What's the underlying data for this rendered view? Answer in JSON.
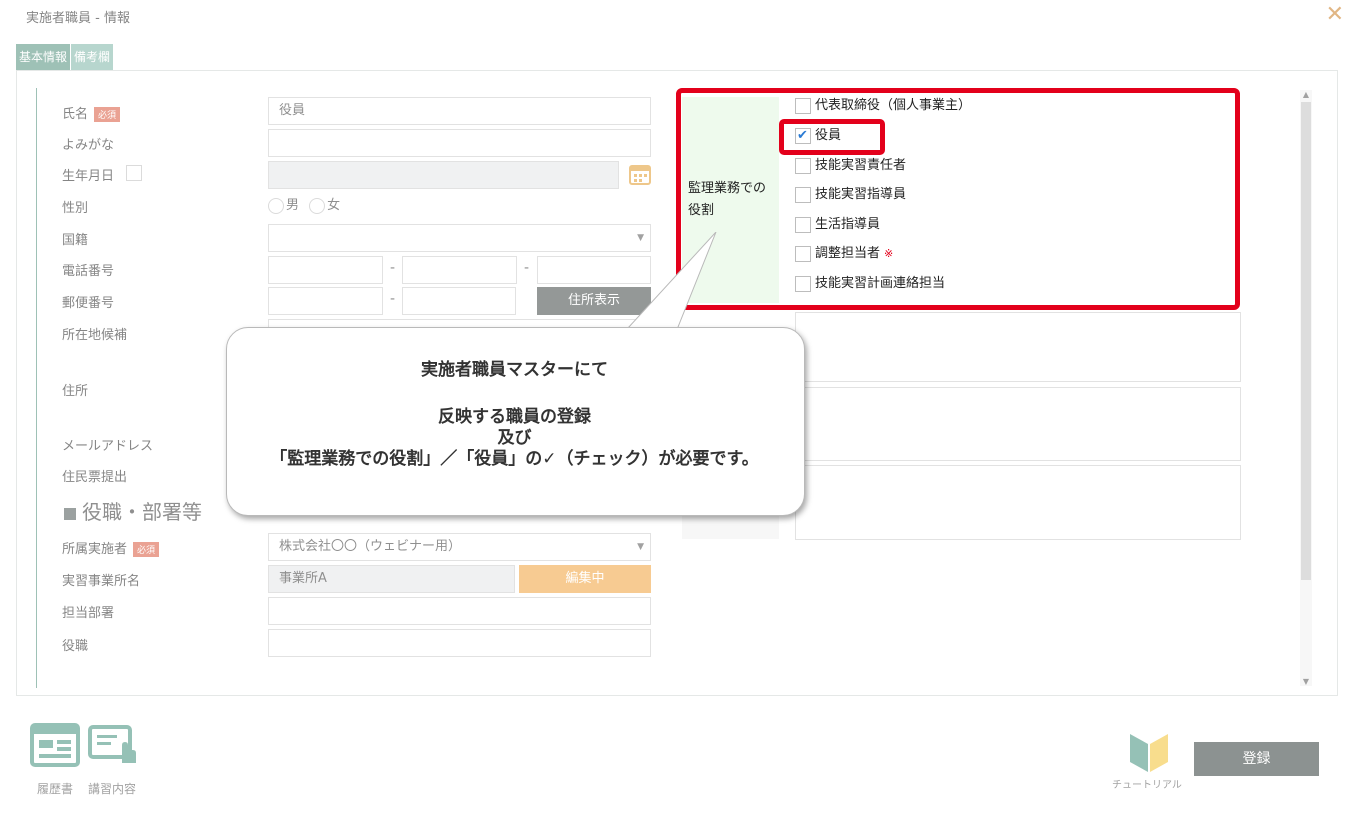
{
  "window": {
    "title": "実施者職員 - 情報",
    "close_glyph": "✕"
  },
  "tabs": [
    {
      "label": "基本情報"
    },
    {
      "label": "備考欄"
    }
  ],
  "form": {
    "name": {
      "label": "氏名",
      "required": "必須",
      "value": "役員"
    },
    "kana": {
      "label": "よみがな",
      "value": ""
    },
    "birth": {
      "label": "生年月日"
    },
    "gender": {
      "label": "性別",
      "male": "男",
      "female": "女"
    },
    "nationality": {
      "label": "国籍"
    },
    "phone": {
      "label": "電話番号",
      "sep": "-"
    },
    "postal": {
      "label": "郵便番号",
      "sep": "-",
      "button": "住所表示"
    },
    "address_candidate": {
      "label": "所在地候補"
    },
    "address": {
      "label": "住所"
    },
    "email": {
      "label": "メールアドレス"
    },
    "resident_card": {
      "label": "住民票提出"
    },
    "section_title": "役職・部署等",
    "implementer": {
      "label": "所属実施者",
      "required": "必須",
      "value": "株式会社〇〇（ウェビナー用）"
    },
    "office": {
      "label": "実習事業所名",
      "value": "事業所A",
      "button": "編集中"
    },
    "department": {
      "label": "担当部署"
    },
    "position": {
      "label": "役職"
    }
  },
  "roles": {
    "heading": "監理業務での役割",
    "items": [
      {
        "label": "代表取締役（個人事業主）",
        "checked": false
      },
      {
        "label": "役員",
        "checked": true
      },
      {
        "label": "技能実習責任者",
        "checked": false
      },
      {
        "label": "技能実習指導員",
        "checked": false
      },
      {
        "label": "生活指導員",
        "checked": false
      },
      {
        "label": "調整担当者",
        "checked": false,
        "note": "※"
      },
      {
        "label": "技能実習計画連絡担当",
        "checked": false
      }
    ],
    "check_glyph": "✔"
  },
  "callout": {
    "line1": "実施者職員マスターにて",
    "line2": "反映する職員の登録",
    "line3": "及び",
    "line4": "「監理業務での役割」／「役員」の✓（チェック）が必要です。"
  },
  "bottom": {
    "resume_label": "履歴書",
    "course_label": "講習内容",
    "tutorial_label": "チュートリアル",
    "register_label": "登録"
  },
  "colors": {
    "accent": "#4f8f7b",
    "highlight": "#e3001b",
    "orange": "#f0a13a"
  }
}
